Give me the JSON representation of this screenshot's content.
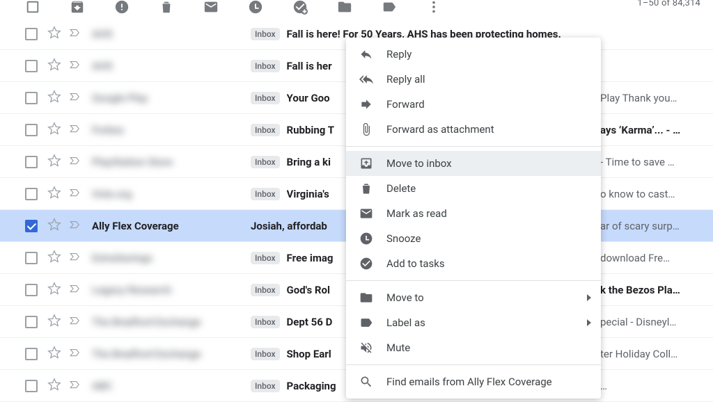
{
  "counter": "1–50 of 84,314",
  "label_text": "Inbox",
  "rows": [
    {
      "sender": "AHS",
      "blur": true,
      "selected": false,
      "showLabel": true,
      "subject": "Fall is here! For 50 Years, AHS has been protecting homes.",
      "right": "",
      "rightBold": false
    },
    {
      "sender": "AHS",
      "blur": true,
      "selected": false,
      "showLabel": true,
      "subject": "Fall is her",
      "right": "",
      "rightBold": false
    },
    {
      "sender": "Google Play",
      "blur": true,
      "selected": false,
      "showLabel": true,
      "subject": "Your Goo",
      "right": "Play Thank you…",
      "rightBold": false
    },
    {
      "sender": "Forbes",
      "blur": true,
      "selected": false,
      "showLabel": true,
      "subject": "Rubbing T",
      "right": "ays ‘Karma’... - …",
      "rightBold": true
    },
    {
      "sender": "PlayStation Store",
      "blur": true,
      "selected": false,
      "showLabel": true,
      "subject": "Bring a ki",
      "right": "- Time to save …",
      "rightBold": false
    },
    {
      "sender": "Vote.org",
      "blur": true,
      "selected": false,
      "showLabel": true,
      "subject": "Virginia's",
      "right": "o know to cast…",
      "rightBold": false
    },
    {
      "sender": "Ally Flex Coverage",
      "blur": false,
      "selected": true,
      "showLabel": false,
      "subject": "Josiah, affordab",
      "right": "ar of scary surp…",
      "rightBold": false
    },
    {
      "sender": "ExtraSavings",
      "blur": true,
      "selected": false,
      "showLabel": true,
      "subject": "Free imag",
      "right": "download Fre…",
      "rightBold": false
    },
    {
      "sender": "Legacy Research",
      "blur": true,
      "selected": false,
      "showLabel": true,
      "subject": "God's Rol",
      "right": "k the Bezos Pla…",
      "rightBold": true
    },
    {
      "sender": "The Bradford Exchange",
      "blur": true,
      "selected": false,
      "showLabel": true,
      "subject": "Dept 56 D",
      "right": "pecial - Disneyl…",
      "rightBold": false
    },
    {
      "sender": "The Bradford Exchange",
      "blur": true,
      "selected": false,
      "showLabel": true,
      "subject": "Shop Earl",
      "right": "ter Holiday Coll…",
      "rightBold": false
    },
    {
      "sender": "ABC",
      "blur": true,
      "selected": false,
      "showLabel": true,
      "subject": "Packaging",
      "right": "…",
      "rightBold": false
    }
  ],
  "menu": {
    "reply": "Reply",
    "reply_all": "Reply all",
    "forward": "Forward",
    "forward_attachment": "Forward as attachment",
    "move_to_inbox": "Move to inbox",
    "delete": "Delete",
    "mark_read": "Mark as read",
    "snooze": "Snooze",
    "add_to_tasks": "Add to tasks",
    "move_to": "Move to",
    "label_as": "Label as",
    "mute": "Mute",
    "find_emails": "Find emails from Ally Flex Coverage"
  }
}
